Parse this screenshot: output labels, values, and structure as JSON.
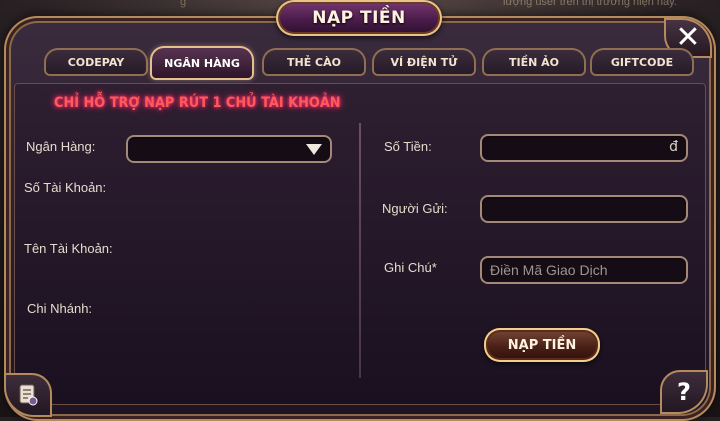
{
  "window": {
    "title": "NẠP TIỀN"
  },
  "background": {
    "top_left_text": "g",
    "top_right_text": "lượng user trên thị trường hiện nay."
  },
  "tabs": [
    {
      "label": "CODEPAY",
      "active": false
    },
    {
      "label": "NGÂN HÀNG",
      "active": true
    },
    {
      "label": "THẺ CÀO",
      "active": false
    },
    {
      "label": "VÍ ĐIỆN TỬ",
      "active": false
    },
    {
      "label": "TIỀN ẢO",
      "active": false
    },
    {
      "label": "GIFTCODE",
      "active": false
    }
  ],
  "notice": "CHỈ HỖ TRỢ NẠP RÚT 1 CHỦ TÀI KHOẢN",
  "left": {
    "bank_label": "Ngân Hàng:",
    "account_number_label": "Số Tài Khoản:",
    "account_name_label": "Tên Tài Khoản:",
    "branch_label": "Chi Nhánh:"
  },
  "right": {
    "amount_label": "Số Tiền:",
    "amount_suffix": "đ",
    "sender_label": "Người Gửi:",
    "note_label": "Ghi Chú*",
    "note_placeholder": "Điền Mã Giao Dịch"
  },
  "submit_label": "NẠP TIỀN",
  "close_icon": "close-icon",
  "help_label": "?",
  "colors": {
    "notice": "#ff5a5a",
    "accent_border": "#e3c08e"
  }
}
